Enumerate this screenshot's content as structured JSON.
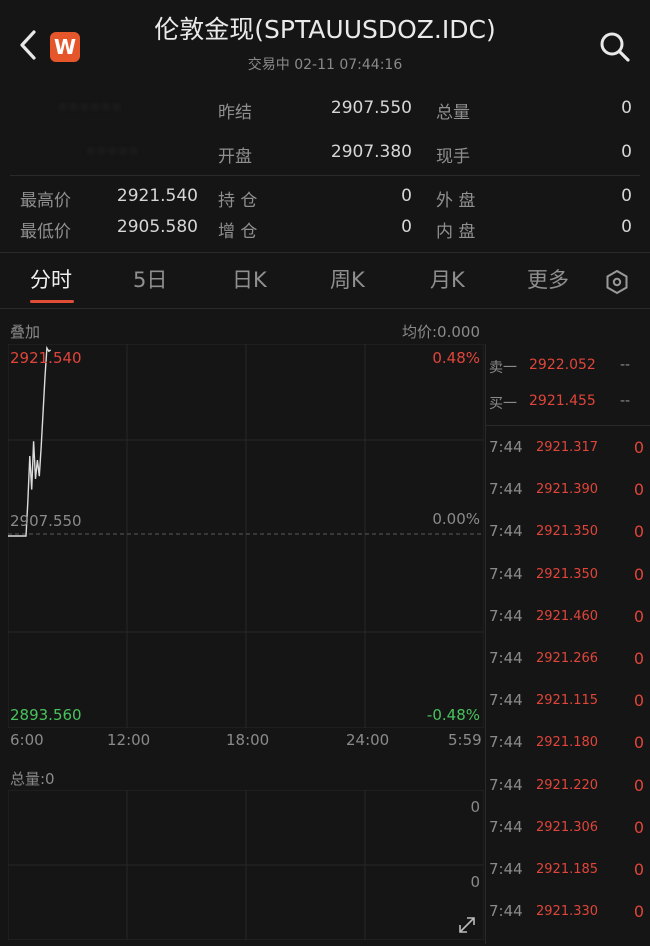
{
  "header": {
    "title": "伦敦金现(SPTAUUSDOZ.IDC)",
    "subtitle": "交易中 02-11 07:44:16",
    "logo_letter": "W"
  },
  "quote": {
    "prev_close_label": "昨结",
    "prev_close": "2907.550",
    "open_label": "开盘",
    "open": "2907.380",
    "total_vol_label": "总量",
    "total_vol": "0",
    "cur_vol_label": "现手",
    "cur_vol": "0",
    "high_label": "最高价",
    "high": "2921.540",
    "low_label": "最低价",
    "low": "2905.580",
    "position_label": "持  仓",
    "position": "0",
    "add_position_label": "增  仓",
    "add_position": "0",
    "outer_label": "外  盘",
    "outer": "0",
    "inner_label": "内  盘",
    "inner": "0"
  },
  "tabs": [
    {
      "label": "分时"
    },
    {
      "label": "5日"
    },
    {
      "label": "日K"
    },
    {
      "label": "周K"
    },
    {
      "label": "月K"
    },
    {
      "label": "更多"
    }
  ],
  "chart": {
    "overlay_label": "叠加",
    "avg_label": "均价:0.000",
    "top_price": "2921.540",
    "top_pct": "0.48%",
    "mid_price": "2907.550",
    "mid_pct": "0.00%",
    "bottom_price": "2893.560",
    "bottom_pct": "-0.48%",
    "x_ticks": [
      "6:00",
      "12:00",
      "18:00",
      "24:00",
      "5:59"
    ],
    "volume_label": "总量:0",
    "vol_tick_top": "0",
    "vol_tick_bottom": "0",
    "colors": {
      "up": "#e0453a",
      "down": "#49c25e",
      "line": "#dcdcdc"
    }
  },
  "chart_data": {
    "type": "line",
    "title": "",
    "xlabel": "",
    "ylabel": "",
    "x_ticks": [
      "6:00",
      "12:00",
      "18:00",
      "24:00",
      "5:59"
    ],
    "ylim": [
      2893.56,
      2921.54
    ],
    "reference": 2907.55,
    "series": [
      {
        "values": [
          2907.55,
          2907.55,
          2907.55,
          2910.2,
          2913.5,
          2911.0,
          2914.6,
          2911.8,
          2913.2,
          2912.0,
          2914.2,
          2916.8,
          2919.4,
          2921.54,
          2921.3,
          2921.4
        ]
      }
    ],
    "grid": true
  },
  "orderbook": {
    "ask_label": "卖一",
    "ask_price": "2922.052",
    "ask_vol": "--",
    "bid_label": "买一",
    "bid_price": "2921.455",
    "bid_vol": "--"
  },
  "trades": [
    {
      "time": "7:44",
      "price": "2921.317",
      "vol": "0"
    },
    {
      "time": "7:44",
      "price": "2921.390",
      "vol": "0"
    },
    {
      "time": "7:44",
      "price": "2921.350",
      "vol": "0"
    },
    {
      "time": "7:44",
      "price": "2921.350",
      "vol": "0"
    },
    {
      "time": "7:44",
      "price": "2921.460",
      "vol": "0"
    },
    {
      "time": "7:44",
      "price": "2921.266",
      "vol": "0"
    },
    {
      "time": "7:44",
      "price": "2921.115",
      "vol": "0"
    },
    {
      "time": "7:44",
      "price": "2921.180",
      "vol": "0"
    },
    {
      "time": "7:44",
      "price": "2921.220",
      "vol": "0"
    },
    {
      "time": "7:44",
      "price": "2921.306",
      "vol": "0"
    },
    {
      "time": "7:44",
      "price": "2921.185",
      "vol": "0"
    },
    {
      "time": "7:44",
      "price": "2921.330",
      "vol": "0"
    }
  ]
}
